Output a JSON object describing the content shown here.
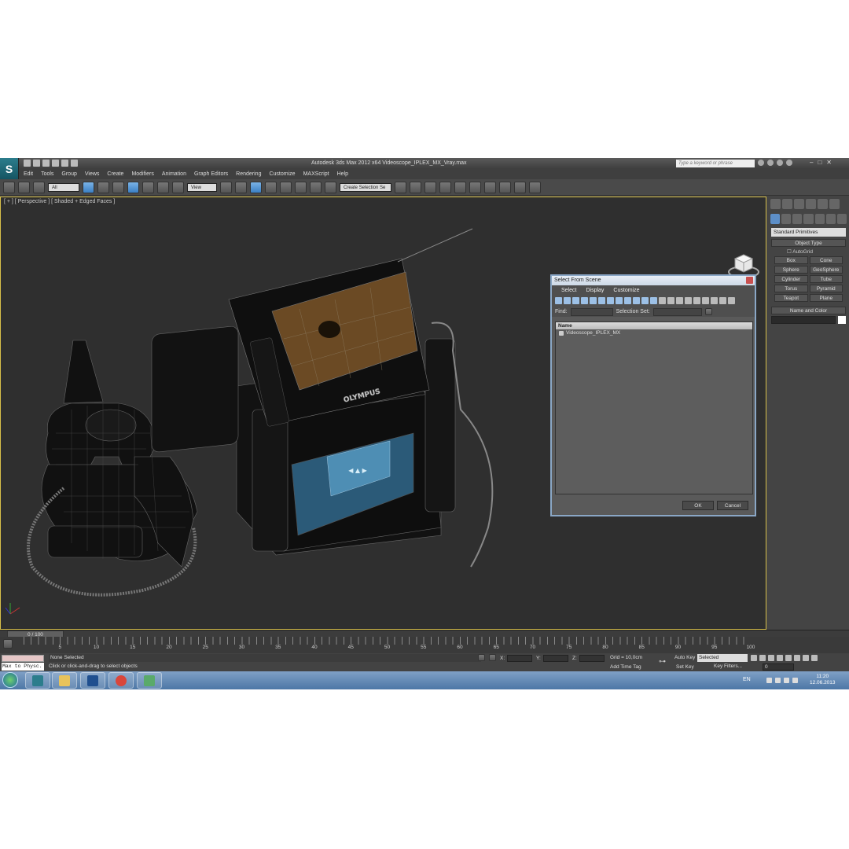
{
  "window": {
    "title": "Autodesk 3ds Max  2012 x64      Videoscope_IPLEX_MX_Vray.max",
    "search_placeholder": "Type a keyword or phrase",
    "logo_letter": "S"
  },
  "menu": [
    "Edit",
    "Tools",
    "Group",
    "Views",
    "Create",
    "Modifiers",
    "Animation",
    "Graph Editors",
    "Rendering",
    "Customize",
    "MAXScript",
    "Help"
  ],
  "toolbar": {
    "filter_value": "All",
    "refcoord_value": "View",
    "selection_set_placeholder": "Create Selection Se"
  },
  "viewport": {
    "label": "[ + ] [ Perspective ] [ Shaded + Edged Faces ]",
    "model_brand": "OLYMPUS"
  },
  "command_panel": {
    "category": "Standard Primitives",
    "object_type_header": "Object Type",
    "autogrid": "AutoGrid",
    "primitives": [
      "Box",
      "Cone",
      "Sphere",
      "GeoSphere",
      "Cylinder",
      "Tube",
      "Torus",
      "Pyramid",
      "Teapot",
      "Plane"
    ],
    "name_color_header": "Name and Color"
  },
  "dialog": {
    "title": "Select From Scene",
    "menu": [
      "Select",
      "Display",
      "Customize"
    ],
    "find_label": "Find:",
    "selection_set_label": "Selection Set:",
    "column_header": "Name",
    "items": [
      "Videoscope_IPLEX_MX"
    ],
    "ok": "OK",
    "cancel": "Cancel"
  },
  "timeline": {
    "slider_text": "0 / 100",
    "ticks": [
      "0",
      "5",
      "10",
      "15",
      "20",
      "25",
      "30",
      "35",
      "40",
      "45",
      "50",
      "55",
      "60",
      "65",
      "70",
      "75",
      "80",
      "85",
      "90",
      "95",
      "100"
    ]
  },
  "status": {
    "script_listener": "Max to Physc.",
    "selection": "None Selected",
    "prompt": "Click or click-and-drag to select objects",
    "x_label": "X:",
    "y_label": "Y:",
    "z_label": "Z:",
    "grid": "Grid = 10,0cm",
    "add_time_tag": "Add Time Tag",
    "auto_key": "Auto Key",
    "set_key": "Set Key",
    "selected_dd": "Selected",
    "key_filters": "Key Filters...",
    "frame": "0"
  },
  "taskbar": {
    "language": "EN",
    "time": "11:20",
    "date": "12.06.2013"
  }
}
